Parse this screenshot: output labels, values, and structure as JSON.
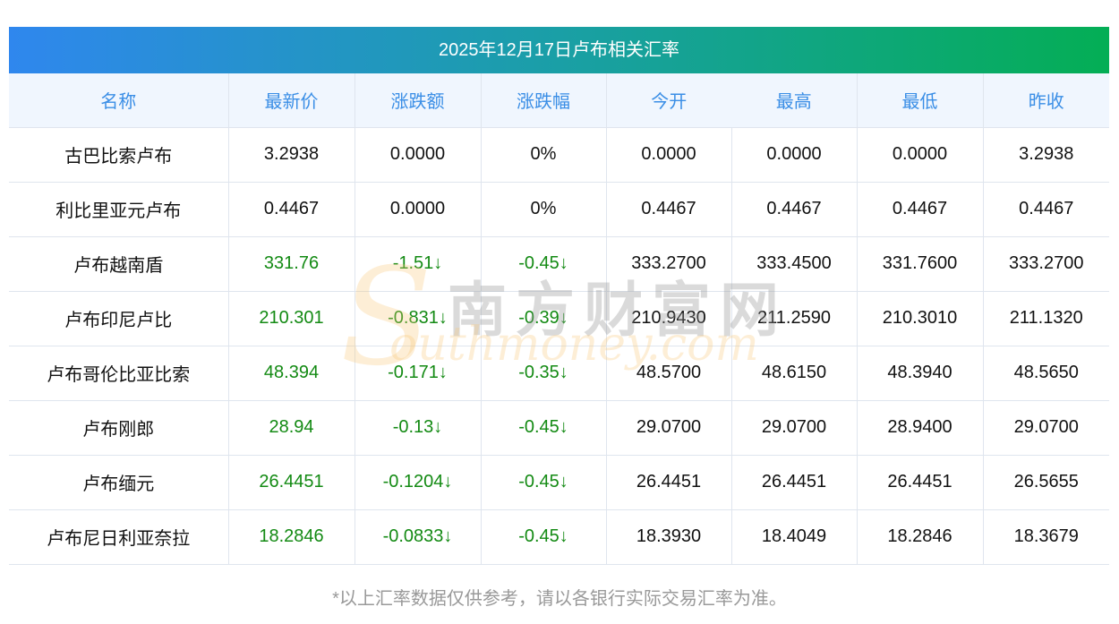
{
  "title": "2025年12月17日卢布相关汇率",
  "columns": [
    "名称",
    "最新价",
    "涨跌额",
    "涨跌幅",
    "今开",
    "最高",
    "最低",
    "昨收"
  ],
  "rows": [
    {
      "name": "古巴比索卢布",
      "latest": "3.2938",
      "change": "0.0000",
      "pct": "0%",
      "open": "0.0000",
      "high": "0.0000",
      "low": "0.0000",
      "prev": "3.2938",
      "down": false
    },
    {
      "name": "利比里亚元卢布",
      "latest": "0.4467",
      "change": "0.0000",
      "pct": "0%",
      "open": "0.4467",
      "high": "0.4467",
      "low": "0.4467",
      "prev": "0.4467",
      "down": false
    },
    {
      "name": "卢布越南盾",
      "latest": "331.76",
      "change": "-1.51↓",
      "pct": "-0.45↓",
      "open": "333.2700",
      "high": "333.4500",
      "low": "331.7600",
      "prev": "333.2700",
      "down": true
    },
    {
      "name": "卢布印尼卢比",
      "latest": "210.301",
      "change": "-0.831↓",
      "pct": "-0.39↓",
      "open": "210.9430",
      "high": "211.2590",
      "low": "210.3010",
      "prev": "211.1320",
      "down": true
    },
    {
      "name": "卢布哥伦比亚比索",
      "latest": "48.394",
      "change": "-0.171↓",
      "pct": "-0.35↓",
      "open": "48.5700",
      "high": "48.6150",
      "low": "48.3940",
      "prev": "48.5650",
      "down": true
    },
    {
      "name": "卢布刚郎",
      "latest": "28.94",
      "change": "-0.13↓",
      "pct": "-0.45↓",
      "open": "29.0700",
      "high": "29.0700",
      "low": "28.9400",
      "prev": "29.0700",
      "down": true
    },
    {
      "name": "卢布缅元",
      "latest": "26.4451",
      "change": "-0.1204↓",
      "pct": "-0.45↓",
      "open": "26.4451",
      "high": "26.4451",
      "low": "26.4451",
      "prev": "26.5655",
      "down": true
    },
    {
      "name": "卢布尼日利亚奈拉",
      "latest": "18.2846",
      "change": "-0.0833↓",
      "pct": "-0.45↓",
      "open": "18.3930",
      "high": "18.4049",
      "low": "18.2846",
      "prev": "18.3679",
      "down": true
    }
  ],
  "footnote": "*以上汇率数据仅供参考，请以各银行实际交易汇率为准。",
  "watermark": {
    "cn": "南方财富网",
    "en": "outhmoney.com",
    "s": "S"
  },
  "colors": {
    "header_text": "#3a8ee6",
    "down": "#138a13",
    "gradient_start": "#2f87ee",
    "gradient_end": "#04ae55"
  }
}
